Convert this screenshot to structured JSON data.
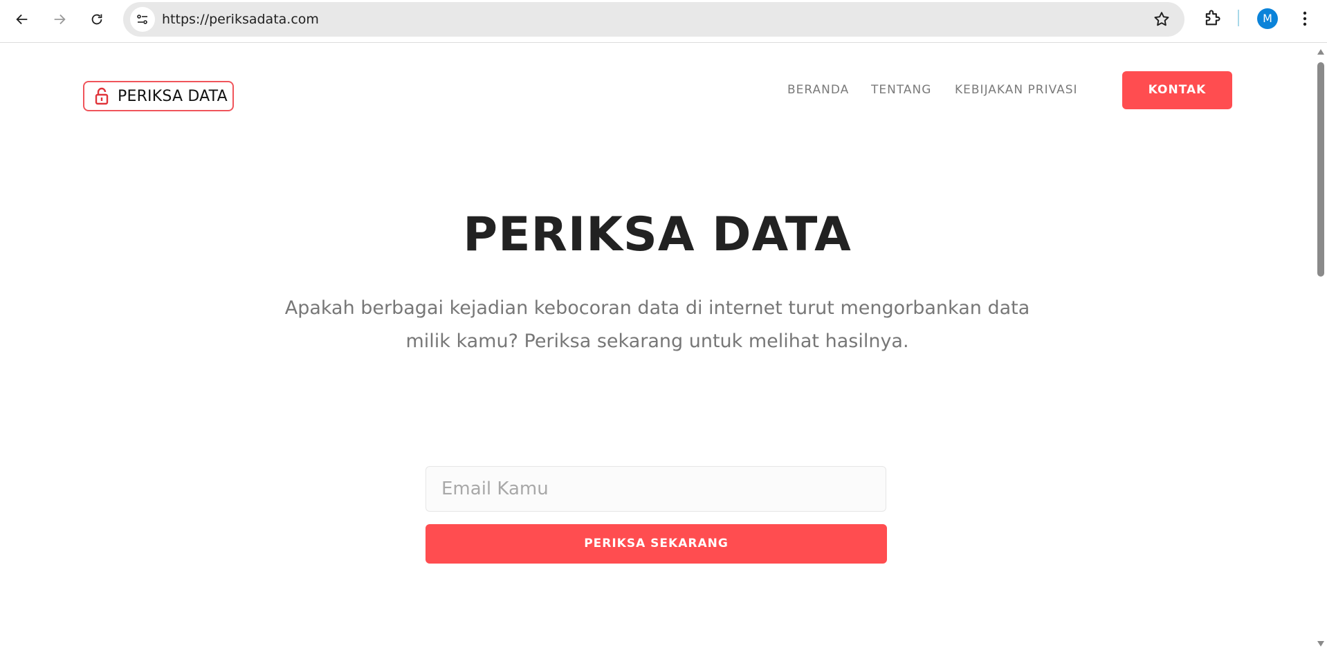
{
  "browser": {
    "url": "https://periksadata.com",
    "profile_initial": "M"
  },
  "site": {
    "logo_text": "PERIKSA DATA",
    "nav": {
      "home": "BERANDA",
      "about": "TENTANG",
      "privacy": "KEBIJAKAN PRIVASI",
      "contact": "KONTAK"
    },
    "hero": {
      "title": "PERIKSA DATA",
      "subtitle": "Apakah berbagai kejadian kebocoran data di internet turut mengorbankan data milik kamu? Periksa sekarang untuk melihat hasilnya."
    },
    "form": {
      "email_placeholder": "Email Kamu",
      "email_value": "",
      "submit_label": "PERIKSA SEKARANG"
    }
  },
  "colors": {
    "accent": "#ff4d50",
    "title": "#222222",
    "muted": "#777777"
  }
}
